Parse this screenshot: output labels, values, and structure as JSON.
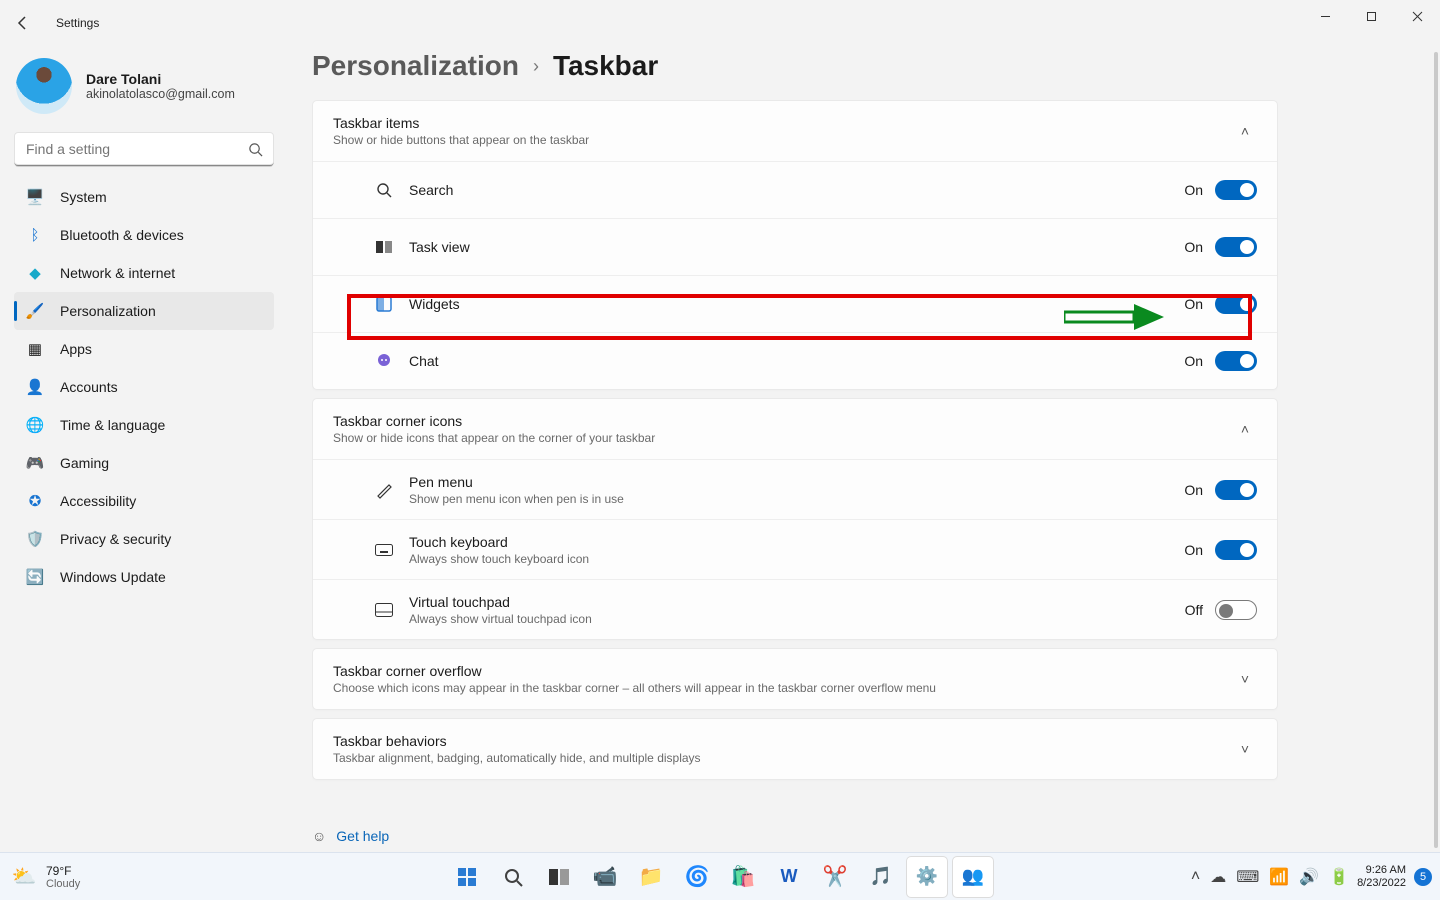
{
  "titlebar": {
    "app": "Settings"
  },
  "profile": {
    "name": "Dare Tolani",
    "email": "akinolatolasco@gmail.com"
  },
  "search": {
    "placeholder": "Find a setting"
  },
  "nav": {
    "items": [
      {
        "label": "System"
      },
      {
        "label": "Bluetooth & devices"
      },
      {
        "label": "Network & internet"
      },
      {
        "label": "Personalization"
      },
      {
        "label": "Apps"
      },
      {
        "label": "Accounts"
      },
      {
        "label": "Time & language"
      },
      {
        "label": "Gaming"
      },
      {
        "label": "Accessibility"
      },
      {
        "label": "Privacy & security"
      },
      {
        "label": "Windows Update"
      }
    ],
    "selected_index": 3
  },
  "breadcrumb": {
    "parent": "Personalization",
    "leaf": "Taskbar"
  },
  "groups": {
    "taskbar_items": {
      "title": "Taskbar items",
      "subtitle": "Show or hide buttons that appear on the taskbar",
      "rows": [
        {
          "label": "Search",
          "state": "On",
          "on": true
        },
        {
          "label": "Task view",
          "state": "On",
          "on": true
        },
        {
          "label": "Widgets",
          "state": "On",
          "on": true
        },
        {
          "label": "Chat",
          "state": "On",
          "on": true
        }
      ]
    },
    "corner_icons": {
      "title": "Taskbar corner icons",
      "subtitle": "Show or hide icons that appear on the corner of your taskbar",
      "rows": [
        {
          "label": "Pen menu",
          "sub": "Show pen menu icon when pen is in use",
          "state": "On",
          "on": true
        },
        {
          "label": "Touch keyboard",
          "sub": "Always show touch keyboard icon",
          "state": "On",
          "on": true
        },
        {
          "label": "Virtual touchpad",
          "sub": "Always show virtual touchpad icon",
          "state": "Off",
          "on": false
        }
      ]
    },
    "overflow": {
      "title": "Taskbar corner overflow",
      "subtitle": "Choose which icons may appear in the taskbar corner – all others will appear in the taskbar corner overflow menu"
    },
    "behaviors": {
      "title": "Taskbar behaviors",
      "subtitle": "Taskbar alignment, badging, automatically hide, and multiple displays"
    }
  },
  "gethelp": "Get help",
  "taskbar": {
    "weather": {
      "temp": "79°F",
      "cond": "Cloudy"
    },
    "clock": {
      "time": "9:26 AM",
      "date": "8/23/2022"
    },
    "notif_count": "5"
  }
}
